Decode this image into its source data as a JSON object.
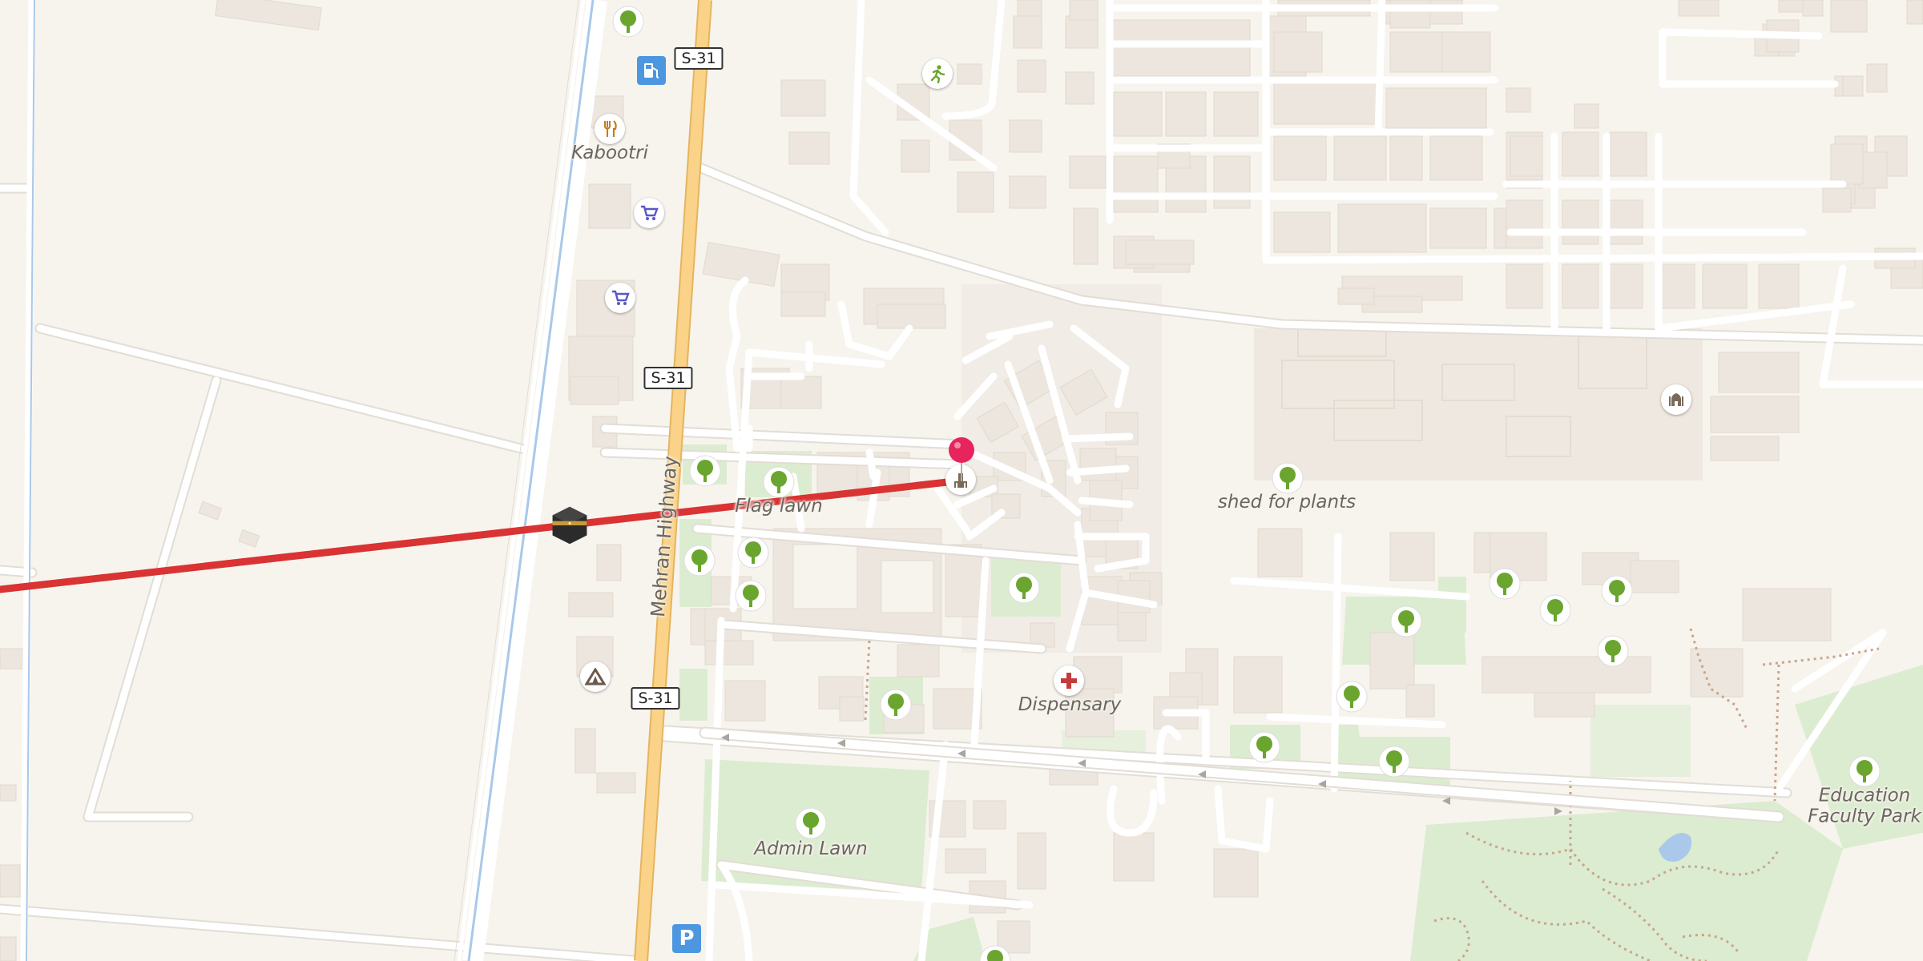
{
  "map": {
    "colors": {
      "land": "#f7f4ee",
      "building": "#ece6de",
      "park": "#dcecd0",
      "road": "#ffffff",
      "road_casing": "#e2ddd5",
      "highway": "#fad389",
      "highway_casing": "#e5b45f",
      "canal": "#a9c8ea",
      "route_line": "#d93333",
      "pin": "#e8245c",
      "tree": "#6aa52f",
      "shop": "#5857c9",
      "food": "#c77b1f"
    },
    "labels": {
      "kabootri": "Kabootri",
      "flag_lawn": "Flag lawn",
      "shed_for_plants": "shed for plants",
      "dispensary": "Dispensary",
      "admin_lawn": "Admin Lawn",
      "education_park_line1": "Education",
      "education_park_line2": "Faculty Park",
      "highway_name": "Mehran Highway"
    },
    "shields": {
      "top": "S-31",
      "middle": "S-31",
      "bottom": "S-31"
    },
    "icons": [
      "fuel-icon",
      "restaurant-icon",
      "shopping-cart-icon",
      "shopping-cart-icon",
      "sports-icon",
      "kaaba-icon",
      "camp-icon",
      "parking-icon",
      "hospital-icon",
      "mosque-icon",
      "monument-icon",
      "tree-icon",
      "location-pin-icon"
    ]
  }
}
